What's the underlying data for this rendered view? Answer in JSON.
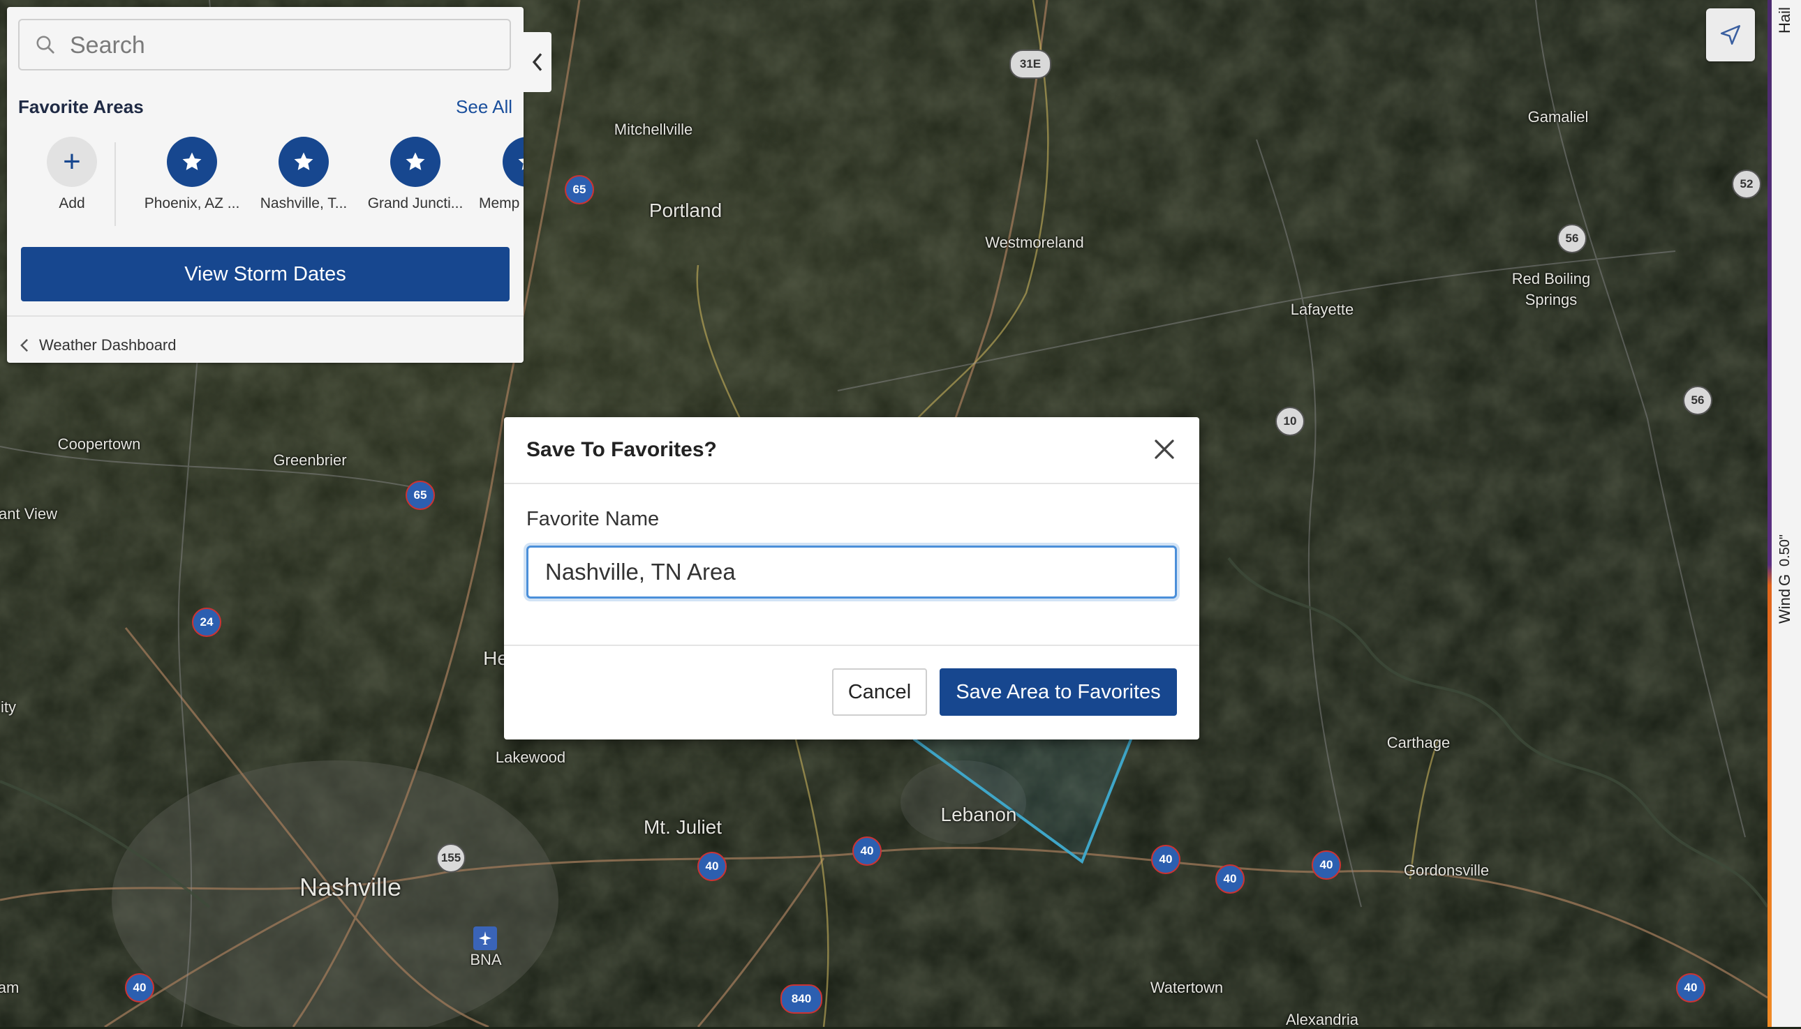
{
  "search": {
    "placeholder": "Search"
  },
  "favorites": {
    "title": "Favorite Areas",
    "see_all": "See All",
    "add_label": "Add",
    "items": [
      {
        "label": "Phoenix, AZ ..."
      },
      {
        "label": "Nashville, T..."
      },
      {
        "label": "Grand Juncti..."
      },
      {
        "label": "Memp"
      }
    ]
  },
  "view_storm_dates": "View Storm Dates",
  "weather_dashboard": "Weather Dashboard",
  "right_strip": {
    "hail": "Hail",
    "size": "0.50\"",
    "wind": "Wind",
    "g": "G"
  },
  "map": {
    "places": [
      "Mitchellville",
      "Portland",
      "Westmoreland",
      "Gamaliel",
      "Red Boiling",
      "Springs",
      "Lafayette",
      "Coopertown",
      "Greenbrier",
      "ant View",
      "ity",
      "He",
      "Lakewood",
      "Mt. Juliet",
      "Lebanon",
      "Carthage",
      "Gordonsville",
      "Nashville",
      "BNA",
      "Watertown",
      "Alexandria",
      "am"
    ],
    "routes": [
      "31E",
      "65",
      "52",
      "56",
      "10",
      "56",
      "65",
      "24",
      "155",
      "40",
      "40",
      "40",
      "40",
      "40",
      "840",
      "40",
      "40"
    ]
  },
  "modal": {
    "title": "Save To Favorites?",
    "field_label": "Favorite Name",
    "field_value": "Nashville, TN Area",
    "cancel": "Cancel",
    "save": "Save Area to Favorites"
  },
  "colors": {
    "primary": "#17478f",
    "focus": "#4b8fd9"
  }
}
